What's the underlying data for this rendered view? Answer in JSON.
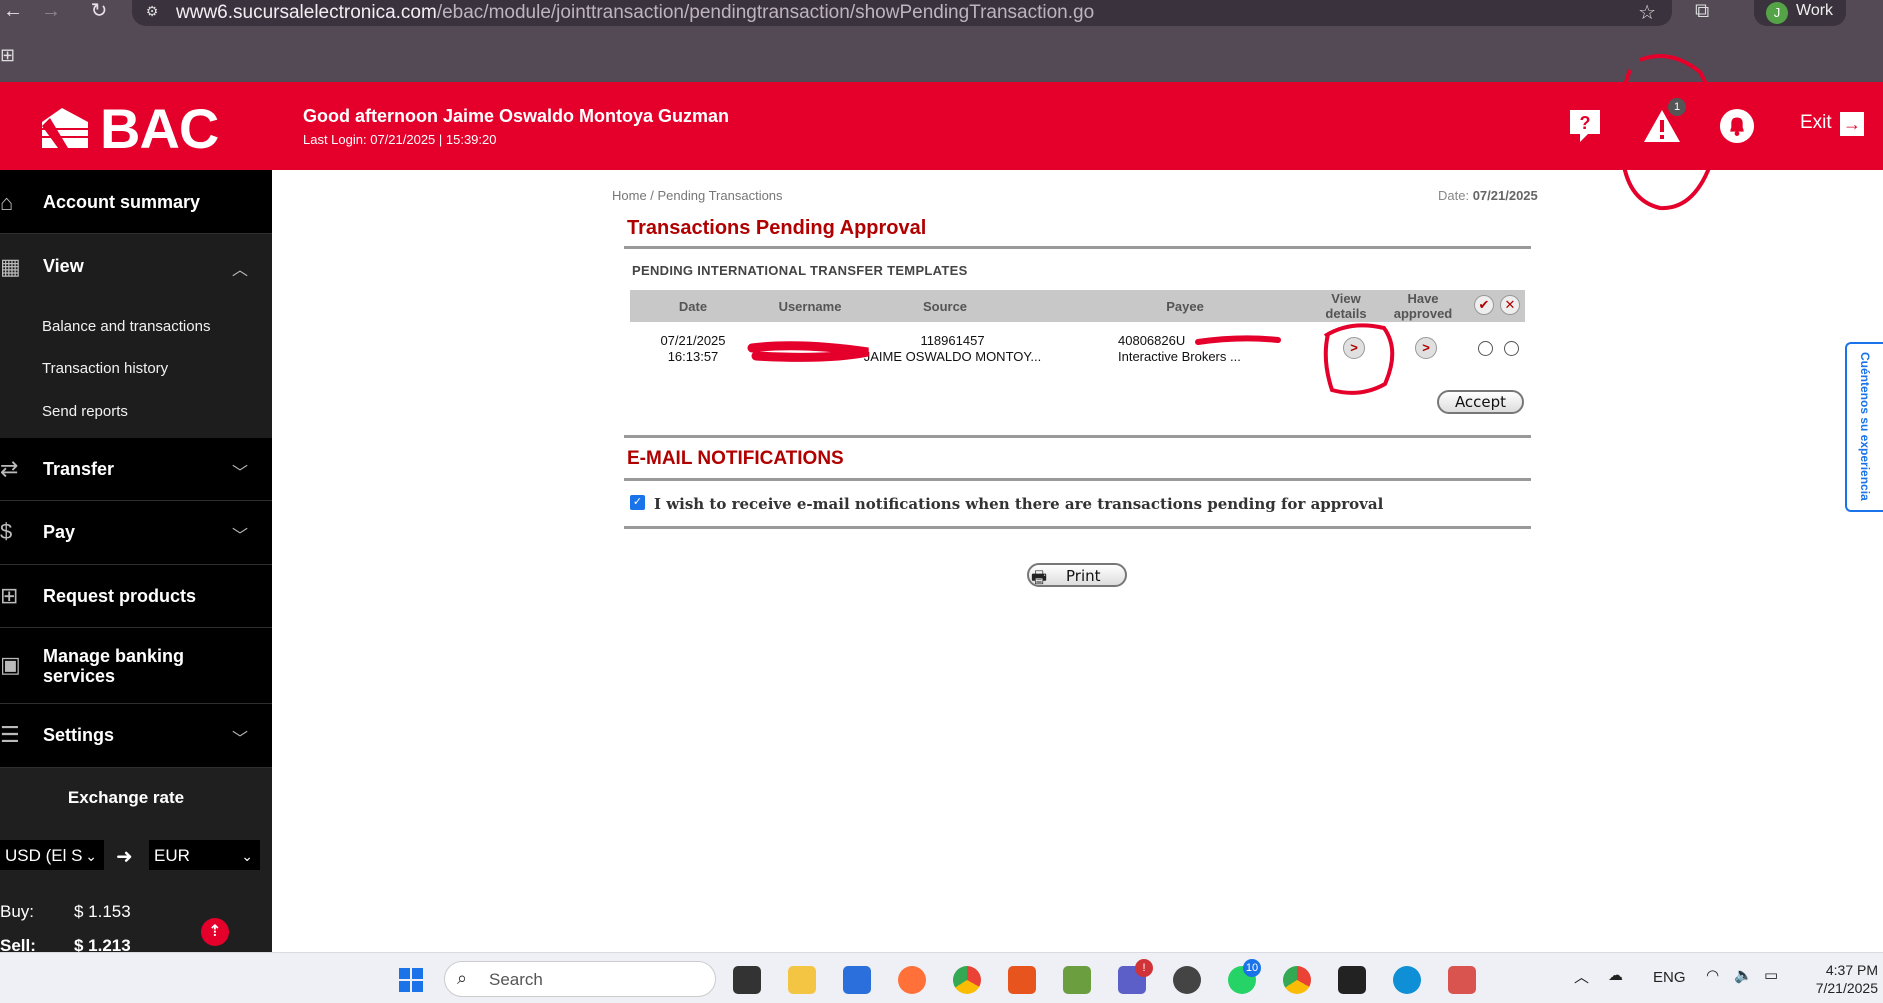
{
  "browser": {
    "url_domain": "www6.sucursalelectronica.com",
    "url_path": "/ebac/module/jointtransaction/pendingtransaction/showPendingTransaction.go",
    "profile_initial": "J",
    "profile_label": "Work"
  },
  "header": {
    "logo_text": "BAC",
    "greeting": "Good afternoon Jaime Oswaldo Montoya Guzman",
    "last_login": "Last Login:  07/21/2025 | 15:39:20",
    "alert_count": "1",
    "help_glyph": "?",
    "exit_label": "Exit",
    "icons": [
      "help-icon",
      "alert-icon",
      "bell-icon",
      "exit-arrow-icon"
    ],
    "brand_color": "#e4002b"
  },
  "sidebar": {
    "items": [
      {
        "label": "Account summary",
        "icon": "home-icon"
      },
      {
        "label": "View",
        "icon": "grid-icon",
        "expanded": true
      },
      {
        "label": "Transfer",
        "icon": "transfer-icon"
      },
      {
        "label": "Pay",
        "icon": "money-bag-icon"
      },
      {
        "label": "Request products",
        "icon": "plus-box-icon"
      },
      {
        "label": "Manage banking services",
        "icon": "banking-icon"
      },
      {
        "label": "Settings",
        "icon": "sliders-icon"
      }
    ],
    "view_subitems": [
      "Balance and transactions",
      "Transaction history",
      "Send reports"
    ],
    "exchange": {
      "title": "Exchange rate",
      "from": "USD (El S",
      "to": "EUR",
      "buy_label": "Buy:",
      "buy_value": "$ 1.153",
      "sell_label": "Sell:",
      "sell_value": "$ 1.213"
    }
  },
  "main": {
    "breadcrumb": "Home / Pending Transactions",
    "date_label": "Date:",
    "date_value": "07/21/2025",
    "title": "Transactions Pending Approval",
    "section_title": "PENDING INTERNATIONAL TRANSFER TEMPLATES",
    "columns": [
      "Date",
      "Username",
      "Source",
      "Payee",
      "View details",
      "Have approved"
    ],
    "rows": [
      {
        "date": "07/21/2025",
        "time": "16:13:57",
        "username": "",
        "source_account": "118961457",
        "source_name": "JAIME OSWALDO MONTOY...",
        "payee_account": "40806826U",
        "payee_name": "Interactive Brokers ..."
      }
    ],
    "accept_label": "Accept",
    "email_title": "E-MAIL NOTIFICATIONS",
    "email_checkbox_label": "I wish to receive e-mail notifications when there are transactions pending for approval",
    "email_checked": true,
    "print_label": "Print",
    "feedback_tab": "Cuéntenos su experiencia"
  },
  "taskbar": {
    "search_placeholder": "Search",
    "language": "ENG",
    "time": "4:37 PM",
    "date": "7/21/2025",
    "whatsapp_badge": "10",
    "apps": [
      "windows-start-icon",
      "task-view-icon",
      "file-explorer-icon",
      "store-icon",
      "firefox-icon",
      "chrome-icon",
      "remote-icon",
      "chart-app-icon",
      "teams-icon",
      "clock-app-icon",
      "whatsapp-icon",
      "chrome-profile-icon",
      "terminal-icon",
      "edge-icon",
      "snipping-icon"
    ]
  }
}
